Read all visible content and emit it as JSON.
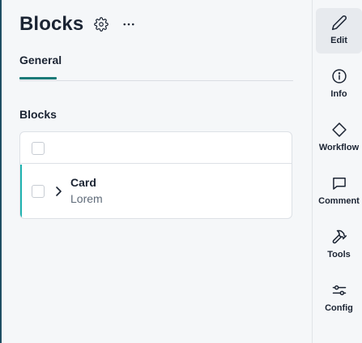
{
  "header": {
    "title": "Blocks"
  },
  "tabs": [
    {
      "label": "General"
    }
  ],
  "section": {
    "label": "Blocks"
  },
  "blocks": {
    "rows": [
      {
        "title": "Card",
        "subtitle": "Lorem"
      }
    ]
  },
  "sidebar": {
    "items": [
      {
        "label": "Edit",
        "icon": "pencil-icon"
      },
      {
        "label": "Info",
        "icon": "info-icon"
      },
      {
        "label": "Workflow",
        "icon": "diamond-icon"
      },
      {
        "label": "Comment",
        "icon": "comment-icon"
      },
      {
        "label": "Tools",
        "icon": "hammer-icon"
      },
      {
        "label": "Config",
        "icon": "sliders-icon"
      }
    ]
  },
  "colors": {
    "accent": "#1b7a78",
    "row_accent": "#1fb2b0",
    "text": "#1b2433"
  }
}
